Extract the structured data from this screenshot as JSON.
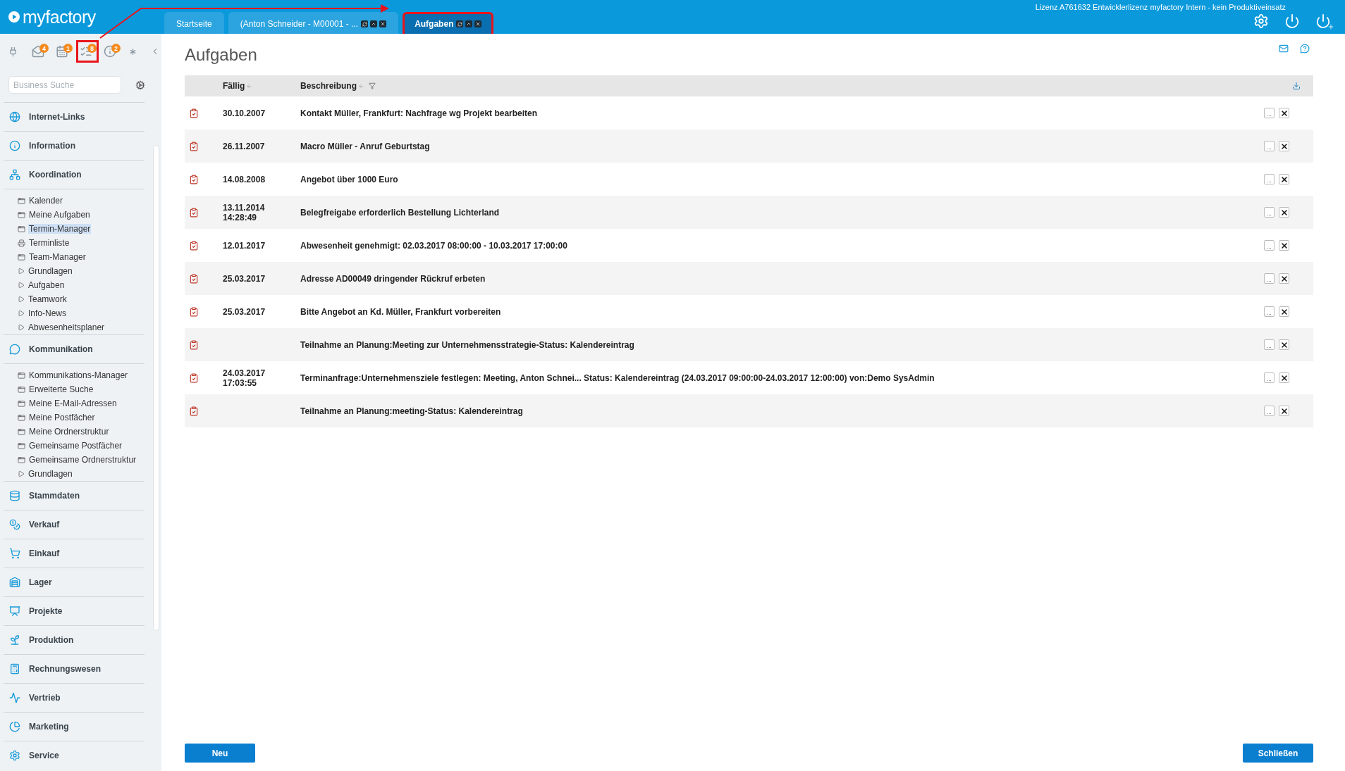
{
  "header": {
    "logo": "myfactory",
    "license": "Lizenz A761632 Entwicklerlizenz myfactory Intern - kein Produktiveinsatz",
    "tabs": [
      {
        "label": "Startseite",
        "selected": false,
        "controls": false,
        "marked": false
      },
      {
        "label": "(Anton Schneider - M00001 - ...",
        "selected": false,
        "controls": true,
        "marked": false
      },
      {
        "label": "Aufgaben",
        "selected": true,
        "controls": true,
        "marked": true
      }
    ]
  },
  "toolbar": [
    {
      "kind": "plug",
      "marked": false
    },
    {
      "kind": "mail",
      "badge": "4",
      "marked": false
    },
    {
      "kind": "calendar",
      "badge": "1",
      "marked": false
    },
    {
      "kind": "tasks",
      "badge": "8",
      "marked": true
    },
    {
      "kind": "info",
      "badge": "2",
      "marked": false
    },
    {
      "kind": "asterisk",
      "marked": false
    }
  ],
  "search": {
    "placeholder": "Business Suche"
  },
  "nav": [
    {
      "label": "Internet-Links"
    },
    {
      "label": "Information"
    },
    {
      "label": "Koordination",
      "children": [
        {
          "label": "Kalender",
          "kind": "page",
          "selected": false
        },
        {
          "label": "Meine Aufgaben",
          "kind": "page",
          "selected": false
        },
        {
          "label": "Termin-Manager",
          "kind": "page",
          "selected": true
        },
        {
          "label": "Terminliste",
          "kind": "print",
          "selected": false
        },
        {
          "label": "Team-Manager",
          "kind": "page",
          "selected": false
        },
        {
          "label": "Grundlagen",
          "kind": "folder",
          "selected": false
        },
        {
          "label": "Aufgaben",
          "kind": "folder",
          "selected": false
        },
        {
          "label": "Teamwork",
          "kind": "folder",
          "selected": false
        },
        {
          "label": "Info-News",
          "kind": "folder",
          "selected": false
        },
        {
          "label": "Abwesenheitsplaner",
          "kind": "folder",
          "selected": false
        }
      ]
    },
    {
      "label": "Kommunikation",
      "children": [
        {
          "label": "Kommunikations-Manager",
          "kind": "page",
          "selected": false
        },
        {
          "label": "Erweiterte Suche",
          "kind": "page",
          "selected": false
        },
        {
          "label": "Meine E-Mail-Adressen",
          "kind": "page",
          "selected": false
        },
        {
          "label": "Meine Postfächer",
          "kind": "page",
          "selected": false
        },
        {
          "label": "Meine Ordnerstruktur",
          "kind": "page",
          "selected": false
        },
        {
          "label": "Gemeinsame Postfächer",
          "kind": "page",
          "selected": false
        },
        {
          "label": "Gemeinsame Ordnerstruktur",
          "kind": "page",
          "selected": false
        },
        {
          "label": "Grundlagen",
          "kind": "folder",
          "selected": false
        }
      ]
    },
    {
      "label": "Stammdaten"
    },
    {
      "label": "Verkauf"
    },
    {
      "label": "Einkauf"
    },
    {
      "label": "Lager"
    },
    {
      "label": "Projekte"
    },
    {
      "label": "Produktion"
    },
    {
      "label": "Rechnungswesen"
    },
    {
      "label": "Vertrieb"
    },
    {
      "label": "Marketing"
    },
    {
      "label": "Service"
    }
  ],
  "page": {
    "title": "Aufgaben",
    "columns": [
      "Fällig",
      "Beschreibung"
    ],
    "more_label": "...",
    "rows": [
      {
        "due": "30.10.2007",
        "description": "Kontakt Müller, Frankfurt: Nachfrage wg Projekt bearbeiten"
      },
      {
        "due": "26.11.2007",
        "description": "Macro Müller - Anruf Geburtstag"
      },
      {
        "due": "14.08.2008",
        "description": "Angebot über 1000 Euro"
      },
      {
        "due": "13.11.2014",
        "due_time": "14:28:49",
        "description": "Belegfreigabe erforderlich Bestellung Lichterland"
      },
      {
        "due": "12.01.2017",
        "description": "Abwesenheit genehmigt: 02.03.2017 08:00:00 - 10.03.2017 17:00:00"
      },
      {
        "due": "25.03.2017",
        "description": "Adresse AD00049 dringender Rückruf erbeten"
      },
      {
        "due": "25.03.2017",
        "description": "Bitte Angebot an Kd. Müller, Frankfurt vorbereiten"
      },
      {
        "description": "Teilnahme an Planung:Meeting zur Unternehmensstrategie-Status: Kalendereintrag"
      },
      {
        "due": "24.03.2017",
        "due_time": "17:03:55",
        "description": "Terminanfrage:Unternehmensziele festlegen: Meeting, Anton Schnei... Status: Kalendereintrag (24.03.2017 09:00:00-24.03.2017 12:00:00) von:Demo SysAdmin"
      },
      {
        "description": "Teilnahme an Planung:meeting-Status: Kalendereintrag"
      }
    ]
  },
  "buttons": [
    {
      "label": "Neu"
    },
    {
      "label": "Schließen"
    }
  ]
}
